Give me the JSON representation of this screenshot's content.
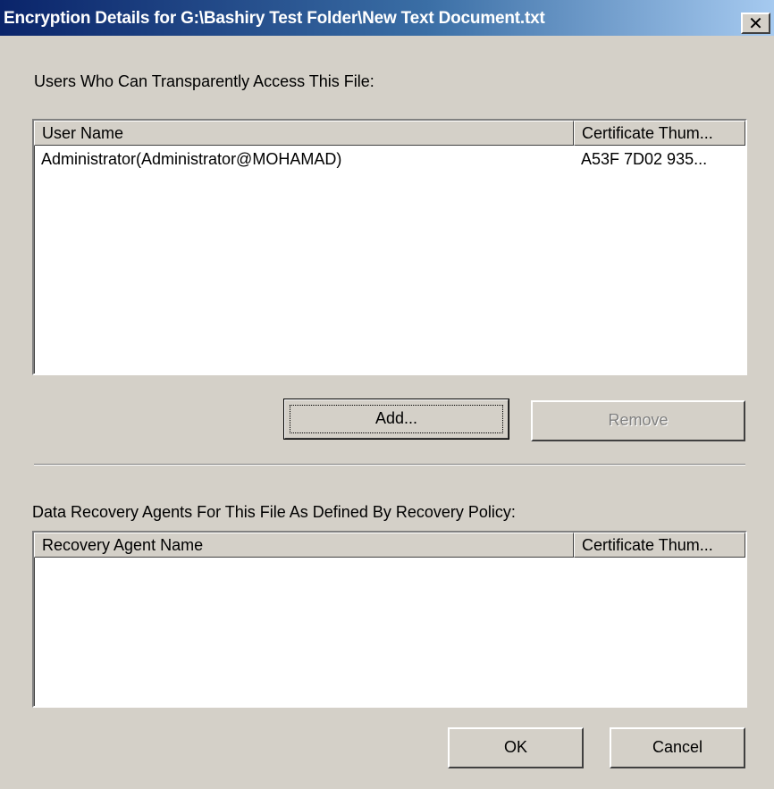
{
  "window": {
    "title": "Encryption Details for G:\\Bashiry Test Folder\\New Text Document.txt",
    "close_glyph": "✕"
  },
  "users_section": {
    "label": "Users Who Can Transparently Access This File:",
    "columns": [
      "User Name",
      "Certificate Thum..."
    ],
    "rows": [
      {
        "user_name": "Administrator(Administrator@MOHAMAD)",
        "thumbprint": "A53F 7D02 935..."
      }
    ]
  },
  "buttons": {
    "add": "Add...",
    "remove": "Remove",
    "ok": "OK",
    "cancel": "Cancel"
  },
  "recovery_section": {
    "label": "Data Recovery Agents For This File As Defined By Recovery Policy:",
    "columns": [
      "Recovery Agent Name",
      "Certificate Thum..."
    ],
    "rows": []
  },
  "colors": {
    "titlebar_start": "#0a246a",
    "titlebar_end": "#a6caf0",
    "face": "#d4d0c8",
    "disabled_text": "#808080"
  }
}
